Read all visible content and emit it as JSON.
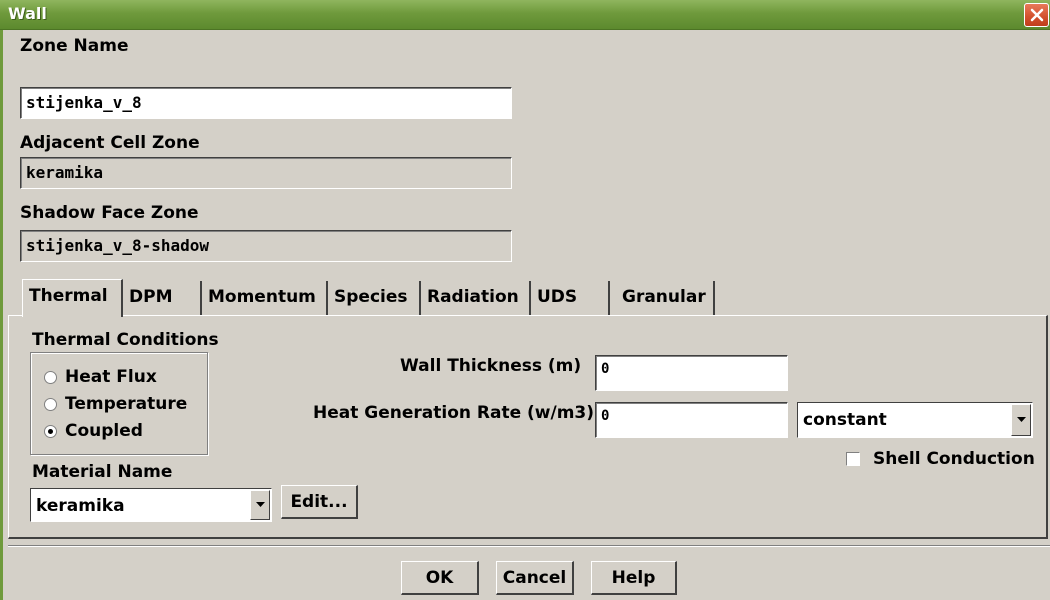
{
  "window": {
    "title": "Wall"
  },
  "zone_name": {
    "label": "Zone Name",
    "value": "stijenka_v_8"
  },
  "adjacent_cell_zone": {
    "label": "Adjacent Cell Zone",
    "value": "keramika"
  },
  "shadow_face_zone": {
    "label": "Shadow Face Zone",
    "value": "stijenka_v_8-shadow"
  },
  "tabs": [
    {
      "label": "Thermal"
    },
    {
      "label": "DPM"
    },
    {
      "label": "Momentum"
    },
    {
      "label": "Species"
    },
    {
      "label": "Radiation"
    },
    {
      "label": "UDS"
    },
    {
      "label": "Granular"
    }
  ],
  "thermal": {
    "conditions_label": "Thermal Conditions",
    "options": [
      {
        "label": "Heat Flux",
        "checked": false
      },
      {
        "label": "Temperature",
        "checked": false
      },
      {
        "label": "Coupled",
        "checked": true
      }
    ],
    "wall_thickness_label": "Wall Thickness (m)",
    "wall_thickness_value": "0",
    "heat_gen_label": "Heat Generation Rate (w/m3)",
    "heat_gen_value": "0",
    "heat_gen_method": "constant",
    "shell_conduction_label": "Shell Conduction",
    "shell_conduction_checked": false,
    "material_label": "Material Name",
    "material_value": "keramika",
    "edit_label": "Edit..."
  },
  "buttons": {
    "ok": "OK",
    "cancel": "Cancel",
    "help": "Help"
  },
  "colors": {
    "titlebar": "#6f9a3c",
    "dialog_bg": "#d4d0c8",
    "close": "#d2502c"
  }
}
